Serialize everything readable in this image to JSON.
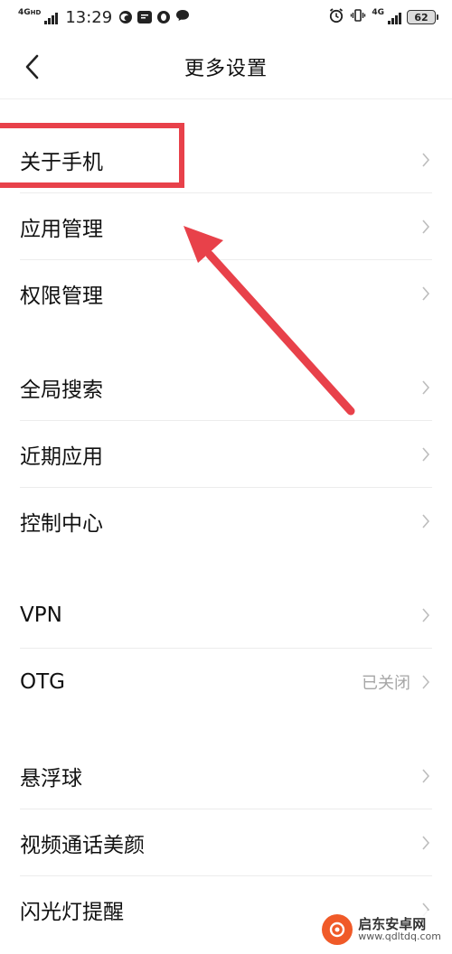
{
  "status_bar": {
    "network_left": "4G",
    "network_left_sub": "HD",
    "time": "13:29",
    "network_right": "4G",
    "battery": "62"
  },
  "header": {
    "title": "更多设置"
  },
  "groups": [
    {
      "items": [
        {
          "label": "关于手机"
        },
        {
          "label": "应用管理"
        },
        {
          "label": "权限管理"
        }
      ]
    },
    {
      "items": [
        {
          "label": "全局搜索"
        },
        {
          "label": "近期应用"
        },
        {
          "label": "控制中心"
        }
      ]
    },
    {
      "items": [
        {
          "label": "VPN"
        },
        {
          "label": "OTG",
          "value": "已关闭"
        }
      ]
    },
    {
      "items": [
        {
          "label": "悬浮球"
        },
        {
          "label": "视频通话美颜"
        },
        {
          "label": "闪光灯提醒"
        }
      ]
    }
  ],
  "annotation": {
    "color": "#e8414a"
  },
  "watermark": {
    "name": "启东安卓网",
    "url": "www.qdltdq.com"
  }
}
